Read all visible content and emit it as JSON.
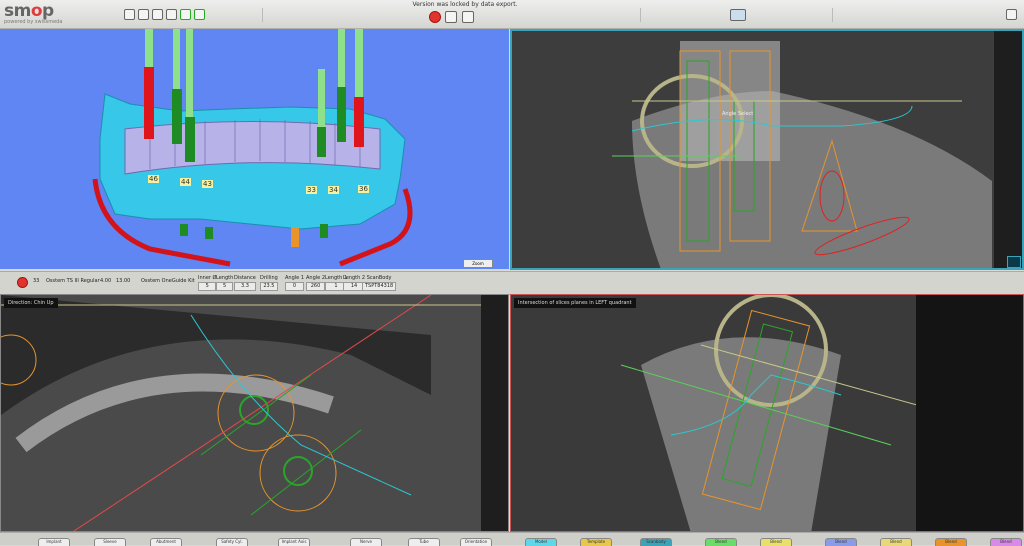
{
  "app": {
    "name": "smop",
    "tagline": "powered by swissmeda"
  },
  "topbar": {
    "lock_message": "Version was locked by data export."
  },
  "view3d": {
    "tooth_labels": [
      "46",
      "44",
      "43",
      "33",
      "34",
      "36"
    ],
    "zoom_select": "Zoom"
  },
  "sliceTR": {
    "annotation": "Angle Select"
  },
  "sliceBL": {
    "label": "Direction: Chin Up"
  },
  "sliceBR": {
    "label": "Intersection of slices planes in LEFT quadrant"
  },
  "params": {
    "tooth": "33",
    "implant": "Osstem TS III Regular",
    "diameter": "4.00",
    "length": "13.00",
    "kit": "Osstem OneGuide Kit",
    "fields": [
      {
        "label": "Inner Ø",
        "value": "5"
      },
      {
        "label": "Length",
        "value": "5"
      },
      {
        "label": "Distance",
        "value": "3.3"
      },
      {
        "label": "Drilling",
        "value": "23.5"
      },
      {
        "label": "Angle 1",
        "value": "0"
      },
      {
        "label": "Angle 2",
        "value": "260"
      },
      {
        "label": "Length 1",
        "value": "1"
      },
      {
        "label": "Length 2",
        "value": "14"
      },
      {
        "label": "ScanBody",
        "value": "TSPT84318"
      }
    ]
  },
  "bottom_tabs": [
    "Implant",
    "Sleeve",
    "Abutment",
    "Safety Cyl.",
    "Implant Axis",
    "Nerve",
    "Tube",
    "Orientation",
    "Model",
    "Template",
    "Scanbody",
    "Blend",
    "Blend",
    "Blend",
    "Blend",
    "Blend",
    "Blend"
  ]
}
